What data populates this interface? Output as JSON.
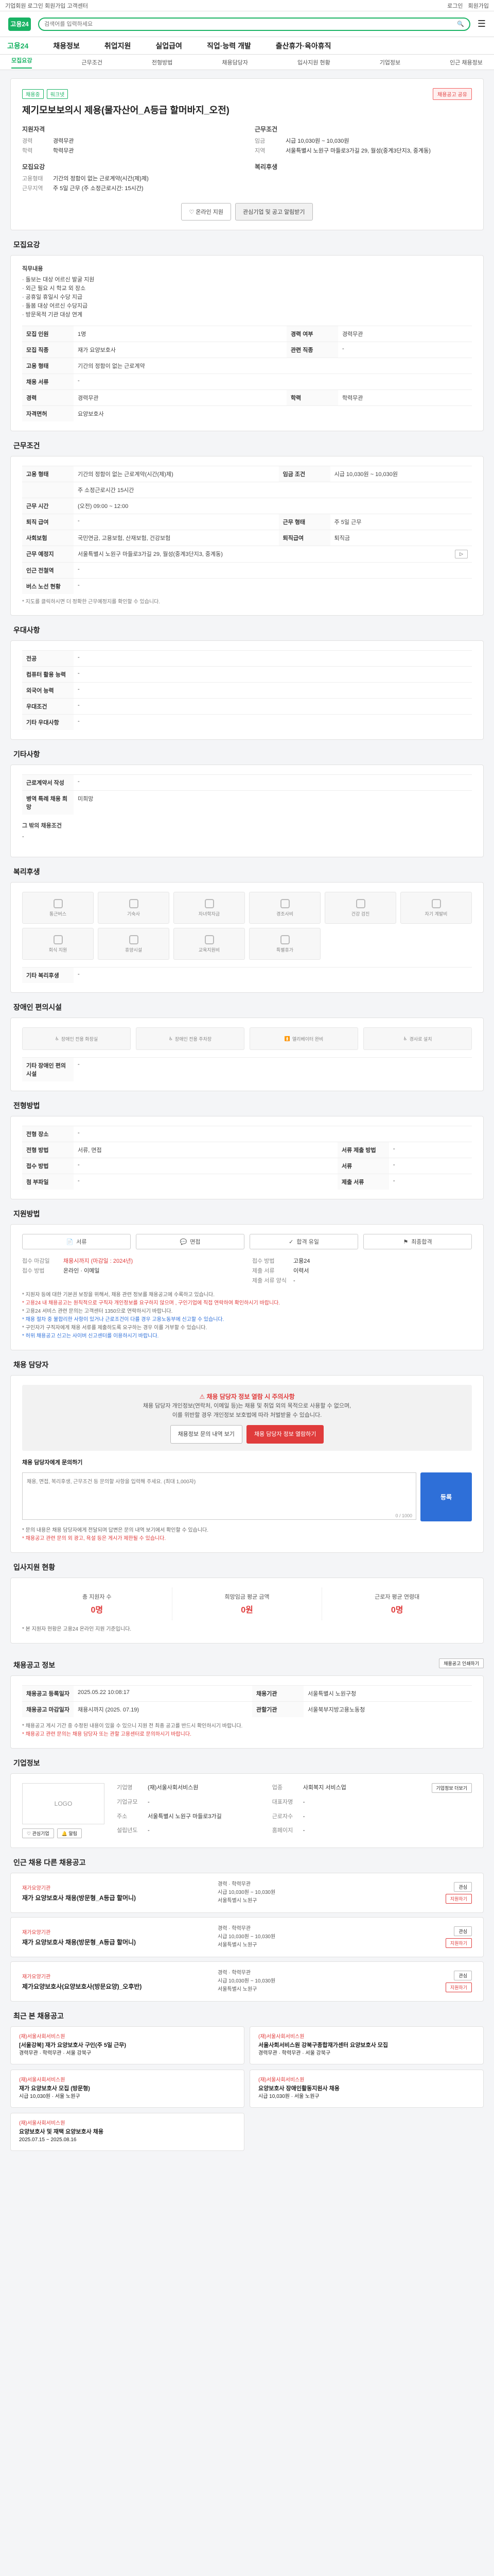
{
  "topbar": {
    "breadcrumb": "기업회원 로그인 회원가입 고객센터",
    "login": "로그인",
    "join": "회원가입"
  },
  "gnb": {
    "logo": "고용24",
    "search_placeholder": "검색어를 입력하세요",
    "menu": [
      "고용24",
      "채용정보",
      "취업지원",
      "실업급여",
      "직업·능력 개발",
      "출산휴가·육아휴직"
    ]
  },
  "subtabs": {
    "items": [
      "모집요강",
      "근무조건",
      "전형방법",
      "채용담당자",
      "입사지원 현황",
      "기업정보",
      "인근 채용정보"
    ]
  },
  "job": {
    "tags": [
      "채용중",
      "워크넷"
    ],
    "share": "채용공고 공유",
    "title": "제기모보보의시 제용(물자산어_A등급 할머바지_오전)",
    "summary": {
      "left_title": "지원자격",
      "left": [
        {
          "k": "경력",
          "v": "경력무관"
        },
        {
          "k": "학력",
          "v": "학력무관"
        }
      ],
      "left2_title": "모집요강",
      "left2": [
        {
          "k": "고용형태",
          "v": "기간의 정함이 없는 근로계약(시간(제)제)"
        },
        {
          "k": "근무지역",
          "v": "주 5일 근무 (주 소정근로시간: 15시간)"
        }
      ],
      "right_title": "근무조건",
      "right": [
        {
          "k": "임금",
          "v": "시급 10,030원 ~ 10,030원"
        },
        {
          "k": "지역",
          "v": "서울특별시 노원구 마들로3가길 29, 월성(중계3단지3, 중계동)"
        }
      ],
      "right2_title": "복리후생",
      "right2": []
    },
    "btn_apply": "온라인 지원",
    "btn_interest": "관심기업 및 공고 알림받기"
  },
  "recruit": {
    "section": "모집요강",
    "duty_title": "직무내용",
    "duty": [
      "· 돌보는 대상 어르신 발굴 지원",
      "· 외근 필요 시 학교 외 장소",
      "· 공휴일 휴일시 수당 지급",
      "· 돌봄 대상 어르신 수당지급",
      "· 방문목적 기관 대상 연계"
    ],
    "rows": [
      {
        "k": "모집 인원",
        "v": "1명",
        "k2": "경력 여부",
        "v2": "경력무관"
      },
      {
        "k": "모집 직종",
        "v": "재가 요양보호사",
        "k2": "관련 직종",
        "v2": "-"
      },
      {
        "k": "고용 형태",
        "v": "기간의 정함이 없는 근로계약",
        "k2": "",
        "v2": ""
      },
      {
        "k": "채용 서류",
        "v": "-",
        "k2": "",
        "v2": ""
      },
      {
        "k": "경력",
        "v": "경력무관",
        "k2": "학력",
        "v2": "학력무관"
      },
      {
        "k": "자격면허",
        "v": "요양보호사",
        "k2": "",
        "v2": ""
      }
    ]
  },
  "work": {
    "section": "근무조건",
    "rows": [
      {
        "k": "고용 형태",
        "v": "기간의 정함이 없는 근로계약(시간(제)제)",
        "k2": "임금 조건",
        "v2": "시급 10,030원 ~ 10,030원"
      },
      {
        "k": "",
        "v": "주 소정근로시간 15시간",
        "k2": "",
        "v2": ""
      },
      {
        "k": "근무 시간",
        "v": "(오전) 09:00 ~ 12:00",
        "k2": "",
        "v2": ""
      },
      {
        "k": "퇴직 급여",
        "v": "-",
        "k2": "근무 형태",
        "v2": "주 5일 근무"
      },
      {
        "k": "사회보험",
        "v": "국민연금, 고용보험, 산재보험, 건강보험",
        "k2": "퇴직급여",
        "v2": "퇴직금"
      },
      {
        "k": "근무 예정지",
        "v": "서울특별시 노원구 마들로3가길 29, 월성(중계3단지3, 중계동)",
        "k2": "",
        "v2": ""
      },
      {
        "k": "인근 전철역",
        "v": "-",
        "k2": "",
        "v2": ""
      },
      {
        "k": "버스 노선 현황",
        "v": "-",
        "k2": "",
        "v2": ""
      }
    ],
    "note": "* 지도를 클릭하시면 더 정확한 근무예정지를 확인할 수 있습니다."
  },
  "prefer": {
    "section": "우대사항",
    "rows": [
      {
        "k": "전공",
        "v": "-"
      },
      {
        "k": "컴퓨터 활용 능력",
        "v": "-"
      },
      {
        "k": "외국어 능력",
        "v": "-"
      },
      {
        "k": "우대조건",
        "v": "-"
      },
      {
        "k": "기타 우대사항",
        "v": "-"
      }
    ]
  },
  "etc": {
    "section": "기타사항",
    "rows": [
      {
        "k": "근로계약서 작성",
        "v": "-"
      },
      {
        "k": "병역 특례 채용 희망",
        "v": "미희망"
      }
    ],
    "extra_title": "그 밖의 채용조건",
    "extra": "-"
  },
  "welfare": {
    "section": "복리후생",
    "items": [
      "통근버스",
      "기숙사",
      "자녀학자금",
      "경조사비",
      "건강 검진",
      "자기 계발비",
      "회식 지원",
      "휴양시설",
      "교육지원비",
      "특별휴가",
      "",
      ""
    ],
    "extra_label": "기타 복리후생",
    "extra": "-"
  },
  "disability": {
    "section": "장애인 편의시설",
    "items": [
      "장애인 전용 화장실",
      "장애인 전용 주차장",
      "엘리베이터 완비",
      "경사로 설치"
    ],
    "extra_label": "기타 장애인 편의시설",
    "extra": "-"
  },
  "selection": {
    "section": "전형방법",
    "rows": [
      {
        "k": "전형 장소",
        "v": "-"
      },
      {
        "k": "전형 방법",
        "v": "서류, 면접",
        "k2": "서류 제출 방법",
        "v2": "-"
      },
      {
        "k": "접수 방법",
        "v": "-",
        "k2": "서류",
        "v2": "-"
      },
      {
        "k": "첨 부파일",
        "v": "-",
        "k2": "제출 서류",
        "v2": "-"
      }
    ]
  },
  "apply": {
    "section": "지원방법",
    "steps": [
      "서류",
      "면접",
      "합격 유일",
      "최종합격"
    ],
    "left": [
      {
        "k": "접수 마감일",
        "v": "채용시까지 (마감일 : 2024년)"
      },
      {
        "k": "접수 방법",
        "v": "온라인 · 이메일"
      }
    ],
    "right": [
      {
        "k": "접수 방법",
        "v": "고용24"
      },
      {
        "k": "제출 서류",
        "v": "이력서"
      },
      {
        "k": "제출 서류 양식",
        "v": "-"
      }
    ],
    "notes": [
      "* 지원자 등에 대한 기본권 보장을 위해서, 채용 관련 정보를 채용공고에 수록하고 있습니다.",
      "* 고용24 내 채용공고는 원칙적으로 구직자 개인정보를 요구하지 않으며 , 구인기업에 직접 연락하여 확인하시기 바랍니다.",
      "* 고용24 서비스 관련 문의는 고객센터 1350으로 연락하시기 바랍니다.",
      "* 채용 절차 중 불합리한 사항이 있거나 근로조건이 다를 경우 고용노동부에 신고할 수 있습니다.",
      "* 구인자가 구직자에게 채용 서류를 제출하도록 요구하는 경우 이를 거부할 수 있습니다.",
      "* 허위 채용공고 신고는 사이버 신고센터를 이용하시기 바랍니다."
    ]
  },
  "manager": {
    "section": "채용 담당자",
    "warn": "채용 담당자 정보 열람 시 주의사항",
    "desc1": "채용 담당자 개인정보(연락처, 이메일 등)는 채용 및 취업 외의 목적으로 사용할 수 없으며,",
    "desc2": "이를 위반할 경우 개인정보 보호법에 따라 처벌받을 수 있습니다.",
    "btn_history": "채용정보 문의 내역 보기",
    "btn_view": "채용 담당자 정보 열람하기",
    "inquiry_title": "채용 담당자에게 문의하기",
    "inquiry_placeholder": "채용, 면접, 복리후생, 근무조건 등 문의할 사항을 입력해 주세요. (최대 1,000자)",
    "inquiry_counter": "0 / 1000",
    "btn_register": "등록",
    "note1": "* 문의 내용은 채용 담당자에게 전달되며 답변은 문의 내역 보기에서 확인할 수 있습니다.",
    "note2": "* 채용공고 관련 문의 외 광고, 욕설 등은 게시가 제한될 수 있습니다."
  },
  "status": {
    "section": "입사지원 현황",
    "stats": [
      {
        "label": "총 지원자 수",
        "num": "0명"
      },
      {
        "label": "희망임금 평균 금액",
        "num": "0원"
      },
      {
        "label": "근로자 평균 연령대",
        "num": "0명"
      }
    ],
    "note": "* 본 지원자 현황은 고용24 온라인 지원 기준입니다."
  },
  "regist": {
    "section": "채용공고 정보",
    "print": "채용공고 인쇄하기",
    "rows": [
      {
        "k": "채용공고 등록일자",
        "v": "2025.05.22 10:08:17",
        "k2": "채용기관",
        "v2": "서울특별시 노원구청"
      },
      {
        "k": "채용공고 마감일자",
        "v": "채용시까지 (2025. 07.19)",
        "k2": "관할기관",
        "v2": "서울북부지방고용노동청"
      }
    ],
    "notes": [
      "* 채용공고 게시 기간 중 수정된 내용이 있을 수 있으니 지원 전 최종 공고를 반드시 확인하시기 바랍니다.",
      "* 채용공고 관련 문의는 채용 담당자 또는 관할 고용센터로 문의하시기 바랍니다."
    ]
  },
  "company": {
    "section": "기업정보",
    "logo_text": "LOGO",
    "btn_info": "기업정보 더보기",
    "rows": [
      {
        "k": "기업명",
        "v": "(재)서울사회서비스원"
      },
      {
        "k": "업종",
        "v": "사회복지 서비스업"
      },
      {
        "k": "기업규모",
        "v": "-"
      },
      {
        "k": "대표자명",
        "v": "-"
      },
      {
        "k": "주소",
        "v": "서울특별시 노원구 마들로3가길"
      },
      {
        "k": "근로자수",
        "v": "-"
      },
      {
        "k": "설립년도",
        "v": "-"
      },
      {
        "k": "홈페이지",
        "v": "-"
      }
    ],
    "btn_interest": "관심기업",
    "btn_alarm": "알림"
  },
  "related": {
    "section": "인근 채용 다른 채용공고",
    "items": [
      {
        "co": "재가요양기관",
        "title": "재가 요양보호사 채용(방문형_A등급 할머니)",
        "info1": "경력 · 학력무관",
        "info2": "시급 10,030원 ~ 10,030원",
        "info3": "서울특별시 노원구",
        "btn1": "관심",
        "btn2": "지원하기"
      },
      {
        "co": "재가요양기관",
        "title": "재가 요양보호사 채용(방문형_A등급 할머니)",
        "info1": "경력 · 학력무관",
        "info2": "시급 10,030원 ~ 10,030원",
        "info3": "서울특별시 노원구",
        "btn1": "관심",
        "btn2": "지원하기"
      },
      {
        "co": "재가요양기관",
        "title": "제가요양보호사(요양보호사(방문요양)_오후반)",
        "info1": "경력 · 학력무관",
        "info2": "시급 10,030원 ~ 10,030원",
        "info3": "서울특별시 노원구",
        "btn1": "관심",
        "btn2": "지원하기"
      }
    ]
  },
  "viewed": {
    "section": "최근 본 채용공고",
    "items": [
      {
        "co": "(재)서울사회서비스원",
        "title": "[서울강북] 재가 요양보호사 구인(주 5일 근무)",
        "info": "경력무관 · 학력무관 · 서울 강북구"
      },
      {
        "co": "(재)서울사회서비스원",
        "title": "서울사회서비스원 강북구종합재가센터 요양보호사 모집",
        "info": "경력무관 · 학력무관 · 서울 강북구"
      },
      {
        "co": "(재)서울사회서비스원",
        "title": "재가 요양보호사 모집 (방문형)",
        "info": "시급 10,030원 · 서울 노원구"
      },
      {
        "co": "(재)서울사회서비스원",
        "title": "요양보호사 장애인활동지원사 채용",
        "info": "시급 10,030원 · 서울 노원구"
      },
      {
        "co": "(재)서울사회서비스원",
        "title": "요양보호사 및 재택 요양보호사 채용",
        "info": "2025.07.15 ~ 2025.08.16"
      }
    ]
  }
}
